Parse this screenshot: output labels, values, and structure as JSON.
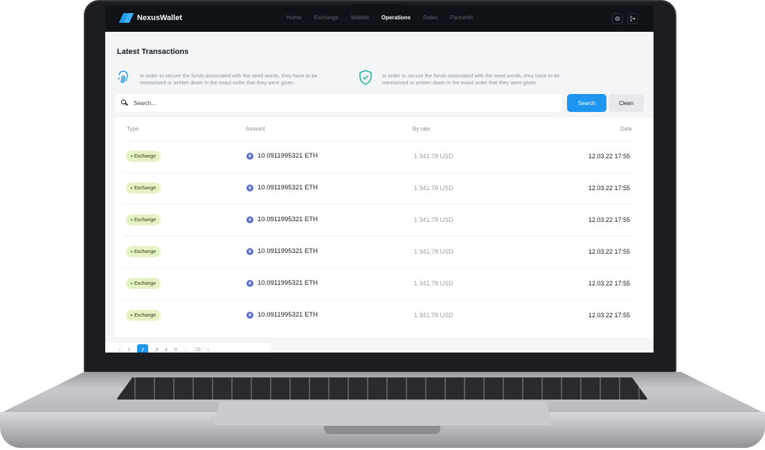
{
  "app": {
    "name": "NexusWallet"
  },
  "nav": {
    "items": [
      {
        "label": "Home",
        "active": false
      },
      {
        "label": "Exchange",
        "active": false
      },
      {
        "label": "Wallets",
        "active": false
      },
      {
        "label": "Operations",
        "active": true
      },
      {
        "label": "Rates",
        "active": false
      },
      {
        "label": "Partnerth",
        "active": false
      }
    ],
    "icons": [
      "settings-icon",
      "logout-icon"
    ]
  },
  "page": {
    "title": "Latest Transactions",
    "info": [
      {
        "icon": "fingerprint-icon",
        "text": "In order to secure the funds associated with the seed words, they have to be memorized or written down in the exact order that they were given."
      },
      {
        "icon": "shield-check-icon",
        "text": "In order to secure the funds associated with the seed words, they have to be memorized or written down in the exact order that they were given."
      }
    ]
  },
  "search": {
    "placeholder": "Search...",
    "search_label": "Search",
    "clean_label": "Clean"
  },
  "table": {
    "headers": {
      "type": "Type",
      "amount": "Amount",
      "rate": "By rate",
      "date": "Date"
    },
    "rows": [
      {
        "type": "Exchange",
        "amount": "10.0911995321 ETH",
        "rate": "1 341.78 USD",
        "date": "12.03.22 17:55"
      },
      {
        "type": "Exchange",
        "amount": "10.0911995321 ETH",
        "rate": "1 341.78 USD",
        "date": "12.03.22 17:55"
      },
      {
        "type": "Exchange",
        "amount": "10.0911995321 ETH",
        "rate": "1 341.78 USD",
        "date": "12.03.22 17:55"
      },
      {
        "type": "Exchange",
        "amount": "10.0911995321 ETH",
        "rate": "1 341.78 USD",
        "date": "12.03.22 17:55"
      },
      {
        "type": "Exchange",
        "amount": "10.0911995321 ETH",
        "rate": "1 341.78 USD",
        "date": "12.03.22 17:55"
      },
      {
        "type": "Exchange",
        "amount": "10.0911995321 ETH",
        "rate": "1 341.78 USD",
        "date": "12.03.22 17:55"
      }
    ]
  },
  "pagination": {
    "prev": "‹",
    "pages": [
      "1",
      "2",
      "3",
      "4",
      "5",
      "...",
      "10"
    ],
    "active_page": "2",
    "next": "›"
  },
  "colors": {
    "accent": "#1e96f0",
    "badge": "#e4f3c4",
    "nav_bg": "#0f1216",
    "teal_icon": "#13b39a"
  }
}
